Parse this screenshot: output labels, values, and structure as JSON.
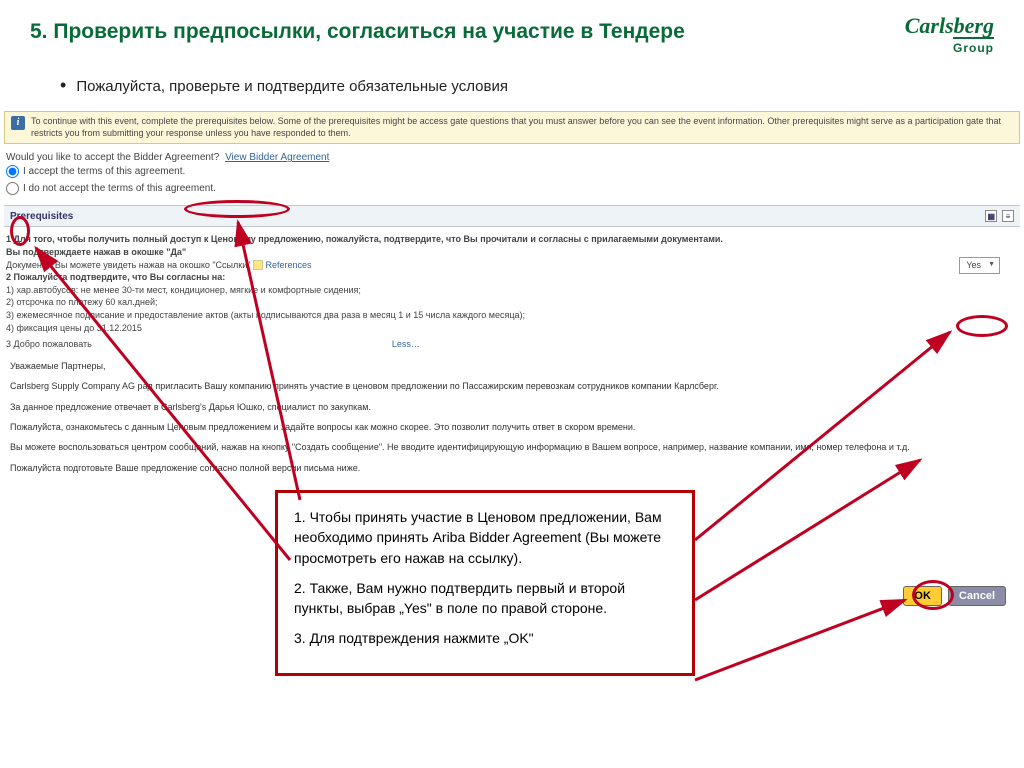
{
  "header": {
    "title": "5. Проверить предпосылки, согласиться на участие в Тендере",
    "logo_main": "Carlsberg",
    "logo_sub": "Group"
  },
  "bullet": "Пожалуйста, проверьте и подтвердите обязательные условия",
  "banner": {
    "text": "To continue with this event, complete the prerequisites below. Some of the prerequisites might be access gate questions that you must answer before you can see the event information. Other prerequisites might serve as a participation gate that restricts you from submitting your response unless you have responded to them."
  },
  "agreement": {
    "question": "Would you like to accept the Bidder Agreement?",
    "view_link": "View Bidder Agreement",
    "opt_accept": "I accept the terms of this agreement.",
    "opt_decline": "I do not accept the terms of this agreement."
  },
  "prereq": {
    "header": "Prerequisites",
    "line1": "1  Для того, чтобы получить полный доступ к Ценовому предложению, пожалуйста, подтвердите, что Вы прочитали и согласны с прилагаемыми документами.",
    "line1b": "Вы подтверждаете нажав в окошке \"Да\"",
    "docs_label": "Документы Вы можете увидеть нажав на окошко \"Ссылки\"",
    "references": "References",
    "line2": "2  Пожалуйста подтвердите, что Вы согласны на:",
    "sub1": "1) хар.автобусов: не менее 30-ти мест, кондиционер, мягкие и комфортные сидения;",
    "sub2": "2) отсрочка по платежу 60 кал.дней;",
    "sub3": "3) ежемесячное подписание и предоставление актов (акты подписываются два раза в месяц 1 и 15 числа каждого месяца);",
    "sub4": "4) фиксация цены до 31.12.2015",
    "yes": "Yes",
    "welcome": "3  Добро пожаловать",
    "less": "Less…"
  },
  "letter": {
    "p1": "Уважаемые Партнеры,",
    "p2": "Carlsberg Supply Company AG рад пригласить Вашу компанию принять участие в ценовом предложении по Пассажирским перевозкам сотрудников компании Карлсберг.",
    "p3": "За данное предложение отвечает в Carlsberg's Дарья Юшко, специалист по закупкам.",
    "p4": "Пожалуйста, ознакомьтесь с данным Ценовым предложением и задайте вопросы как можно скорее. Это позволит получить ответ в скором времени.",
    "p5": "Вы можете воспользоваться центром сообщений, нажав на кнопку \"Создать сообщение\". Не вводите идентифицирующую информацию в Вашем вопросе, например, название компании, имя, номер телефона и т.д.",
    "p6": "Пожалуйста подготовьте Ваше предложение согласно полной версии письма ниже."
  },
  "callout": {
    "p1": "1. Чтобы принять участие в Ценовом предложении, Вам необходимо принять Ariba Bidder Agreement (Вы можете просмотреть его нажав на ссылку).",
    "p2": "2. Также, Вам нужно подтвердить первый и второй пункты, выбрав „Yes\" в поле по правой стороне.",
    "p3": "3. Для подтвреждения нажмите „OK\""
  },
  "buttons": {
    "ok": "OK",
    "cancel": "Cancel"
  }
}
